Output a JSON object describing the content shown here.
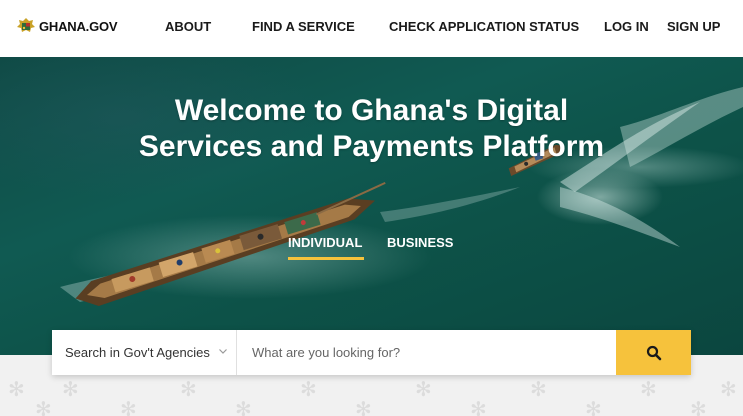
{
  "header": {
    "logo_text": "GHANA.GOV",
    "nav": [
      "ABOUT",
      "FIND A SERVICE",
      "CHECK APPLICATION STATUS",
      "LOG IN",
      "SIGN UP"
    ]
  },
  "hero": {
    "title": "Welcome to Ghana's Digital Services and Payments Platform",
    "tabs": [
      {
        "label": "INDIVIDUAL",
        "active": true
      },
      {
        "label": "BUSINESS",
        "active": false
      }
    ]
  },
  "search": {
    "agency_select": "Search in Gov't Agencies",
    "placeholder": "What are you looking for?",
    "button_icon": "search-icon"
  },
  "colors": {
    "accent": "#f6c23c",
    "hero_sea": "#0f4a45"
  }
}
